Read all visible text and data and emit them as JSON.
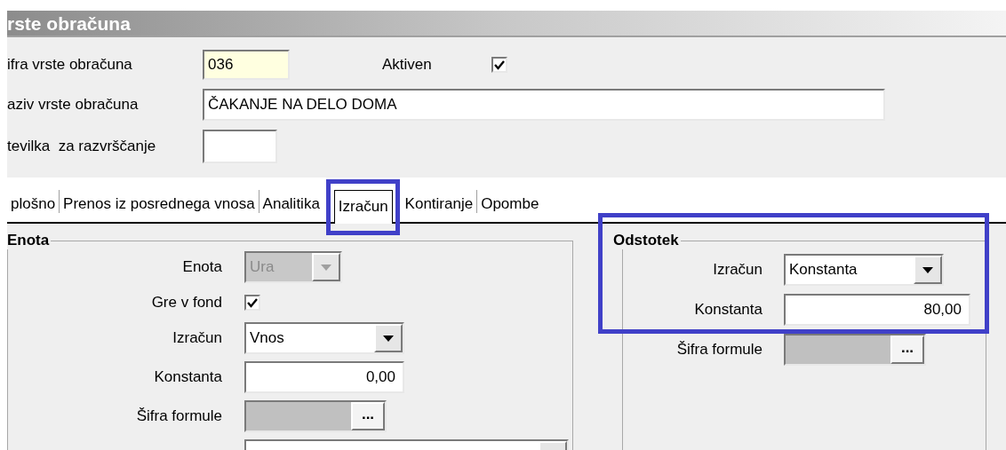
{
  "window": {
    "title": "rste obračuna"
  },
  "header": {
    "fields": [
      {
        "label": "ifra vrste obračuna",
        "value": "036",
        "kind": "code"
      },
      {
        "label": "aziv vrste obračuna",
        "value": "ČAKANJE NA DELO DOMA",
        "kind": "text"
      },
      {
        "label": "tevilka  za razvrščanje",
        "kind": "short"
      }
    ],
    "active": {
      "label": "Aktiven",
      "checked": true
    }
  },
  "tabs": [
    {
      "label": "plošno",
      "selected": false,
      "highlighted": false
    },
    {
      "label": "Prenos iz posrednega vnosa",
      "selected": false,
      "highlighted": false
    },
    {
      "label": "Analitika",
      "selected": false,
      "highlighted": false
    },
    {
      "label": "Izračun",
      "selected": true,
      "highlighted": true
    },
    {
      "label": "Kontiranje",
      "selected": false,
      "highlighted": false
    },
    {
      "label": "Opombe",
      "selected": false,
      "highlighted": false
    }
  ],
  "groups": [
    {
      "title": "Enota",
      "highlighted": false,
      "rows": [
        {
          "kind": "combo",
          "label": "Enota",
          "value": "Ura",
          "disabled": true
        },
        {
          "kind": "checkbox",
          "label": "Gre v fond",
          "checked": true
        },
        {
          "kind": "combo",
          "label": "Izračun",
          "value": "Vnos",
          "disabled": false
        },
        {
          "kind": "number",
          "label": "Konstanta",
          "value": "0,00"
        },
        {
          "kind": "formula",
          "label": "Šifra formule",
          "button": "..."
        },
        {
          "kind": "combo"
        }
      ]
    },
    {
      "title": "Odstotek",
      "highlighted": true,
      "rows": [
        {
          "kind": "combo",
          "label": "Izračun",
          "value": "Konstanta",
          "disabled": false
        },
        {
          "kind": "number",
          "label": "Konstanta",
          "value": "80,00"
        },
        {
          "kind": "formula",
          "label": "Šifra formule",
          "button": "..."
        }
      ]
    }
  ]
}
